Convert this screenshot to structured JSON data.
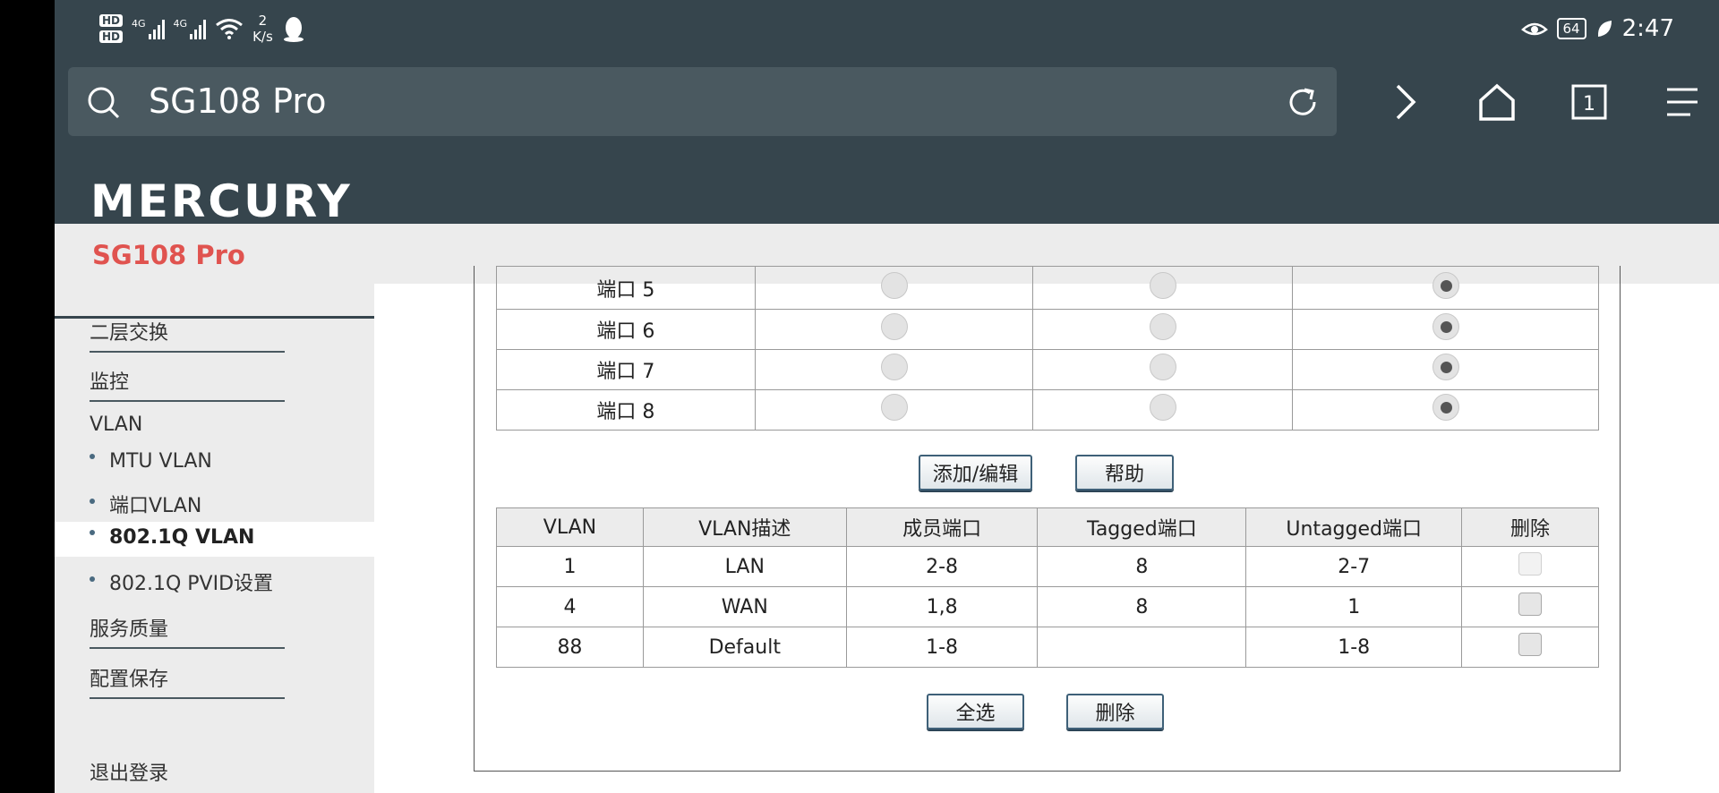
{
  "status_bar": {
    "hd1": "HD",
    "hd2": "HD",
    "sim1_label": "4G",
    "sim2_label": "4G",
    "speed_value": "2",
    "speed_unit": "K/s",
    "battery": "64",
    "time": "2:47",
    "icons": [
      "wifi-icon",
      "qq-penguin-icon",
      "eye-comfort-icon",
      "leaf-icon"
    ]
  },
  "browser": {
    "url": "SG108 Pro",
    "icons": [
      "search-icon",
      "reload-icon",
      "forward-icon",
      "home-icon",
      "tab-count-icon",
      "menu-icon"
    ],
    "tab_count": "1"
  },
  "brand": "MERCURY",
  "page_title": "SG108 Pro",
  "sidebar": {
    "items": [
      {
        "label": "二层交换"
      },
      {
        "label": "监控"
      },
      {
        "label": "VLAN"
      },
      {
        "label": "MTU VLAN"
      },
      {
        "label": "端口VLAN"
      },
      {
        "label": "802.1Q VLAN"
      },
      {
        "label": "802.1Q PVID设置"
      },
      {
        "label": "服务质量"
      },
      {
        "label": "配置保存"
      },
      {
        "label": "退出登录"
      }
    ]
  },
  "port_table": {
    "rows": [
      {
        "port": "端口 5",
        "selected": 3
      },
      {
        "port": "端口 6",
        "selected": 3
      },
      {
        "port": "端口 7",
        "selected": 3
      },
      {
        "port": "端口 8",
        "selected": 3
      }
    ]
  },
  "buttons": {
    "add_edit": "添加/编辑",
    "help": "帮助",
    "select_all": "全选",
    "delete": "删除"
  },
  "vlan_table": {
    "headers": [
      "VLAN",
      "VLAN描述",
      "成员端口",
      "Tagged端口",
      "Untagged端口",
      "删除"
    ],
    "rows": [
      {
        "vlan": "1",
        "desc": "LAN",
        "members": "2-8",
        "tagged": "8",
        "untagged": "2-7"
      },
      {
        "vlan": "4",
        "desc": "WAN",
        "members": "1,8",
        "tagged": "8",
        "untagged": "1"
      },
      {
        "vlan": "88",
        "desc": "Default",
        "members": "1-8",
        "tagged": "",
        "untagged": "1-8"
      }
    ]
  }
}
